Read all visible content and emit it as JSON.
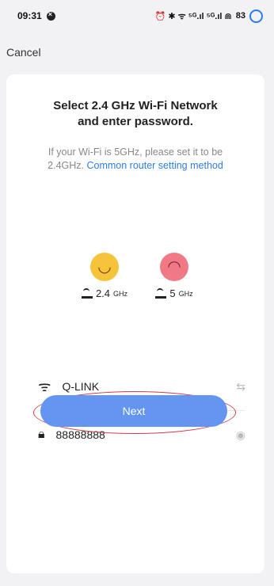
{
  "status_bar": {
    "time": "09:31",
    "right_icons": "⏰ ✱ ᯤ ⁵ᴳ.ıl ⁵ᴳ.ıl ⋒",
    "battery": "83"
  },
  "header": {
    "cancel_label": "Cancel"
  },
  "card": {
    "title_line1": "Select 2.4 GHz Wi-Fi Network",
    "title_line2": "and enter password.",
    "subtitle": "If your Wi-Fi is 5GHz, please set it to be 2.4GHz. ",
    "subtitle_link": "Common router setting method",
    "freq_24": {
      "value": "2.4",
      "unit": "GHz",
      "face": "smiley-icon"
    },
    "freq_5": {
      "value": "5",
      "unit": "GHz",
      "face": "sad-face-icon"
    },
    "wifi_name": "Q-LINK",
    "password": "88888888",
    "next_label": "Next"
  }
}
